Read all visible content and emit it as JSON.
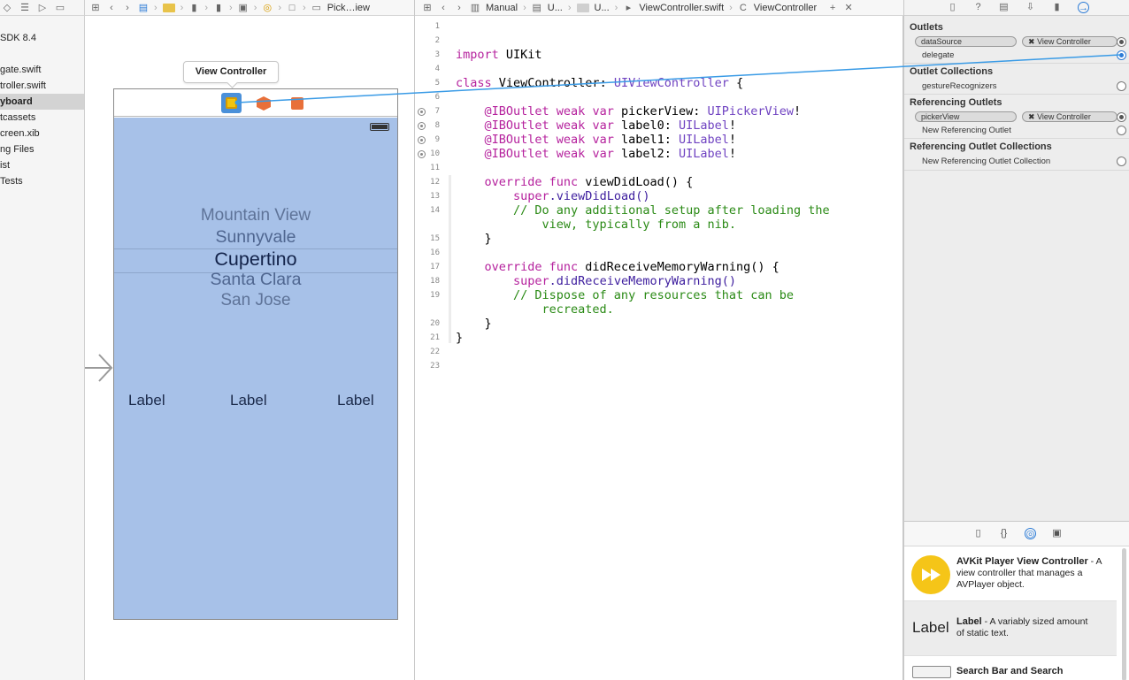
{
  "navigator": {
    "items": [
      {
        "label": "SDK 8.4",
        "selected": false
      },
      {
        "label": "",
        "selected": false
      },
      {
        "label": "gate.swift",
        "selected": false
      },
      {
        "label": "troller.swift",
        "selected": false
      },
      {
        "label": "yboard",
        "selected": true
      },
      {
        "label": "tcassets",
        "selected": false
      },
      {
        "label": "creen.xib",
        "selected": false
      },
      {
        "label": "ng Files",
        "selected": false
      },
      {
        "label": "ist",
        "selected": false
      },
      {
        "label": "Tests",
        "selected": false
      }
    ]
  },
  "jumpbar_left": {
    "last_crumb": "Pick…iew"
  },
  "jumpbar_right": {
    "crumbs": [
      "Manual",
      "U...",
      "U...",
      "ViewController.swift",
      "ViewController"
    ]
  },
  "storyboard": {
    "tooltip": "View Controller",
    "picker_rows": [
      "Mountain View",
      "Sunnyvale",
      "Cupertino",
      "Santa Clara",
      "San Jose"
    ],
    "labels": [
      "Label",
      "Label",
      "Label"
    ],
    "colors": {
      "view_bg": "#a7c1e8",
      "dock_selected": "#4a90d9",
      "connection_line": "#3a9be6"
    }
  },
  "editor": {
    "line_numbers": [
      "1",
      "2",
      "3",
      "4",
      "5",
      "6",
      "7",
      "8",
      "9",
      "10",
      "11",
      "12",
      "13",
      "14",
      "",
      "15",
      "16",
      "17",
      "18",
      "19",
      "",
      "20",
      "21",
      "22",
      "23"
    ],
    "lines": {
      "l3_kw": "import",
      "l3_rest": " UIKit",
      "l5_kw": "class",
      "l5_name": " ViewController",
      "l5_colon": ": ",
      "l5_type": "UIViewController",
      "l5_rest": " {",
      "l7_attr": "    @IBOutlet",
      "l7_kw": " weak var",
      "l7_name": " pickerView: ",
      "l7_type": "UIPickerView",
      "l7_rest": "!",
      "l8_attr": "    @IBOutlet",
      "l8_kw": " weak var",
      "l8_name": " label0: ",
      "l8_type": "UILabel",
      "l8_rest": "!",
      "l9_attr": "    @IBOutlet",
      "l9_kw": " weak var",
      "l9_name": " label1: ",
      "l9_type": "UILabel",
      "l9_rest": "!",
      "l10_attr": "    @IBOutlet",
      "l10_kw": " weak var",
      "l10_name": " label2: ",
      "l10_type": "UILabel",
      "l10_rest": "!",
      "l12_kw": "    override func",
      "l12_rest": " viewDidLoad() {",
      "l13_kw": "        super",
      "l13_rest": ".viewDidLoad()",
      "l14_cm": "        // Do any additional setup after loading the",
      "l14b_cm": "            view, typically from a nib.",
      "l15": "    }",
      "l17_kw": "    override func",
      "l17_rest": " didReceiveMemoryWarning() {",
      "l18_kw": "        super",
      "l18_rest": ".didReceiveMemoryWarning()",
      "l19_cm": "        // Dispose of any resources that can be",
      "l19b_cm": "            recreated.",
      "l20": "    }",
      "l21": "}"
    }
  },
  "inspector": {
    "outlets_title": "Outlets",
    "outlets": [
      {
        "name": "dataSource",
        "target": "View Controller"
      },
      {
        "name": "delegate",
        "target": ""
      }
    ],
    "outlet_collections_title": "Outlet Collections",
    "outlet_collections": [
      "gestureRecognizers"
    ],
    "ref_outlets_title": "Referencing Outlets",
    "ref_outlets": [
      {
        "name": "pickerView",
        "target": "View Controller"
      },
      {
        "name": "New Referencing Outlet",
        "target": ""
      }
    ],
    "ref_outlet_collections_title": "Referencing Outlet Collections",
    "ref_outlet_collections": [
      "New Referencing Outlet Collection"
    ],
    "remove_glyph": "✖"
  },
  "library": {
    "items": [
      {
        "title": "AVKit Player View Controller",
        "desc_a": " - ",
        "desc_b": "A view controller that manages a AVPlayer object."
      },
      {
        "title": "Label",
        "desc_a": " - A variably sized amount",
        "desc_b": "of static text.",
        "icon_text": "Label"
      },
      {
        "title": "Search Bar and Search",
        "desc_a": "",
        "desc_b": ""
      }
    ]
  }
}
